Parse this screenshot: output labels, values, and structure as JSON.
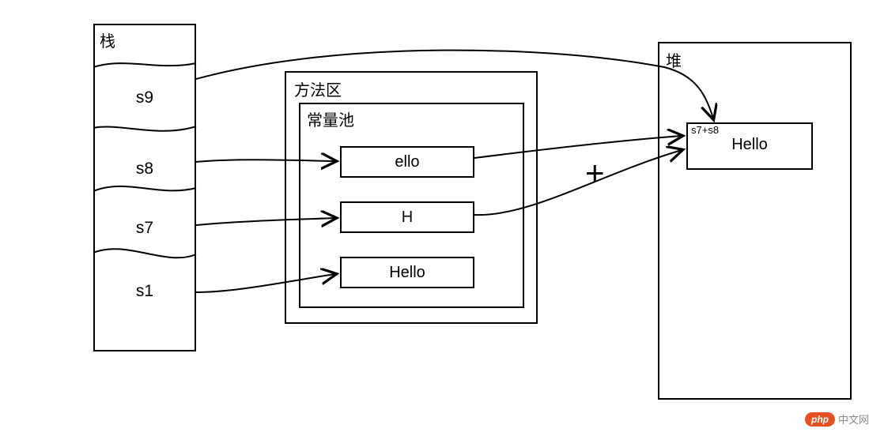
{
  "stack": {
    "title": "栈",
    "cells": [
      "s9",
      "s8",
      "s7",
      "s1"
    ]
  },
  "method_area": {
    "title": "方法区",
    "pool": {
      "title": "常量池",
      "entries": [
        "ello",
        "H",
        "Hello"
      ]
    }
  },
  "heap": {
    "title": "堆",
    "object": {
      "note": "s7+s8",
      "value": "Hello"
    }
  },
  "operator": "+",
  "watermark": {
    "badge": "php",
    "text": "中文网"
  }
}
